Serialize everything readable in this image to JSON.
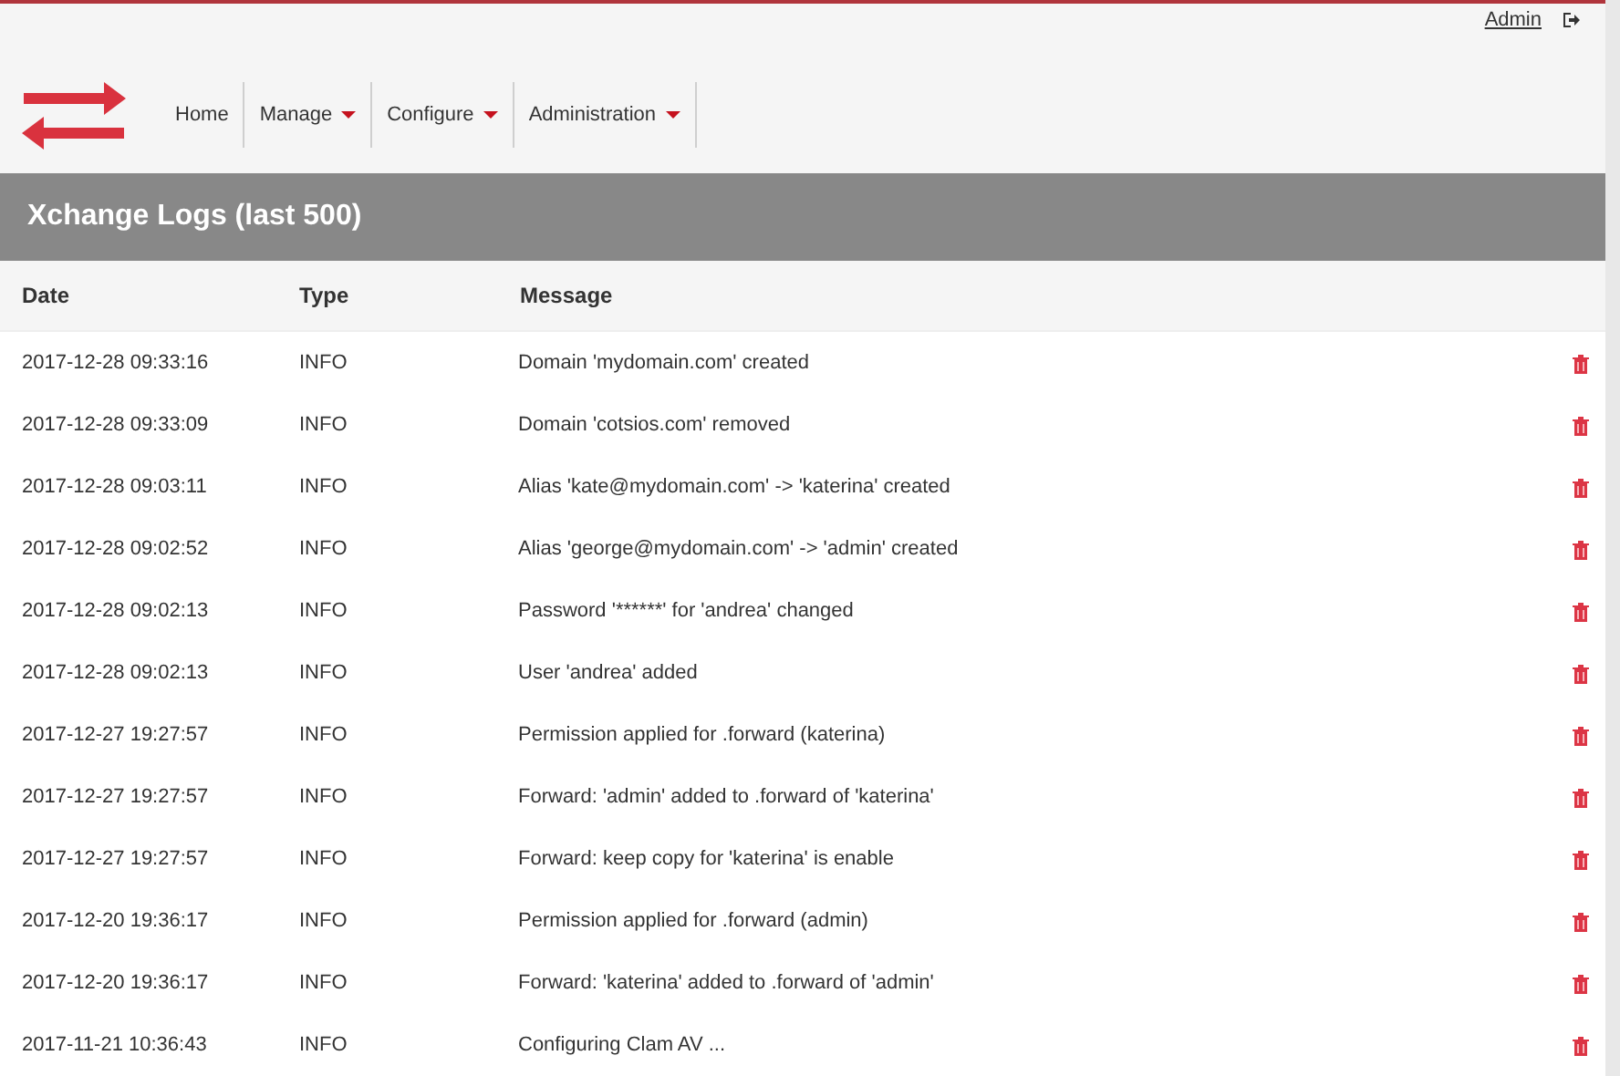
{
  "user_bar": {
    "user_link": "Admin"
  },
  "nav": [
    {
      "label": "Home",
      "has_menu": false
    },
    {
      "label": "Manage",
      "has_menu": true
    },
    {
      "label": "Configure",
      "has_menu": true
    },
    {
      "label": "Administration",
      "has_menu": true
    }
  ],
  "panel": {
    "title": "Xchange Logs (last 500)"
  },
  "table": {
    "columns": [
      "Date",
      "Type",
      "Message"
    ],
    "rows": [
      {
        "date": "2017-12-28 09:33:16",
        "type": "INFO",
        "message": "Domain 'mydomain.com' created"
      },
      {
        "date": "2017-12-28 09:33:09",
        "type": "INFO",
        "message": "Domain 'cotsios.com' removed"
      },
      {
        "date": "2017-12-28 09:03:11",
        "type": "INFO",
        "message": "Alias 'kate@mydomain.com' -> 'katerina' created"
      },
      {
        "date": "2017-12-28 09:02:52",
        "type": "INFO",
        "message": "Alias 'george@mydomain.com' -> 'admin' created"
      },
      {
        "date": "2017-12-28 09:02:13",
        "type": "INFO",
        "message": "Password '******' for 'andrea' changed"
      },
      {
        "date": "2017-12-28 09:02:13",
        "type": "INFO",
        "message": "User 'andrea' added"
      },
      {
        "date": "2017-12-27 19:27:57",
        "type": "INFO",
        "message": "Permission applied for .forward (katerina)"
      },
      {
        "date": "2017-12-27 19:27:57",
        "type": "INFO",
        "message": "Forward: 'admin' added to .forward of 'katerina'"
      },
      {
        "date": "2017-12-27 19:27:57",
        "type": "INFO",
        "message": "Forward: keep copy for 'katerina' is enable"
      },
      {
        "date": "2017-12-20 19:36:17",
        "type": "INFO",
        "message": "Permission applied for .forward (admin)"
      },
      {
        "date": "2017-12-20 19:36:17",
        "type": "INFO",
        "message": "Forward: 'katerina' added to .forward of 'admin'"
      },
      {
        "date": "2017-11-21 10:36:43",
        "type": "INFO",
        "message": "Configuring Clam AV ..."
      }
    ]
  }
}
